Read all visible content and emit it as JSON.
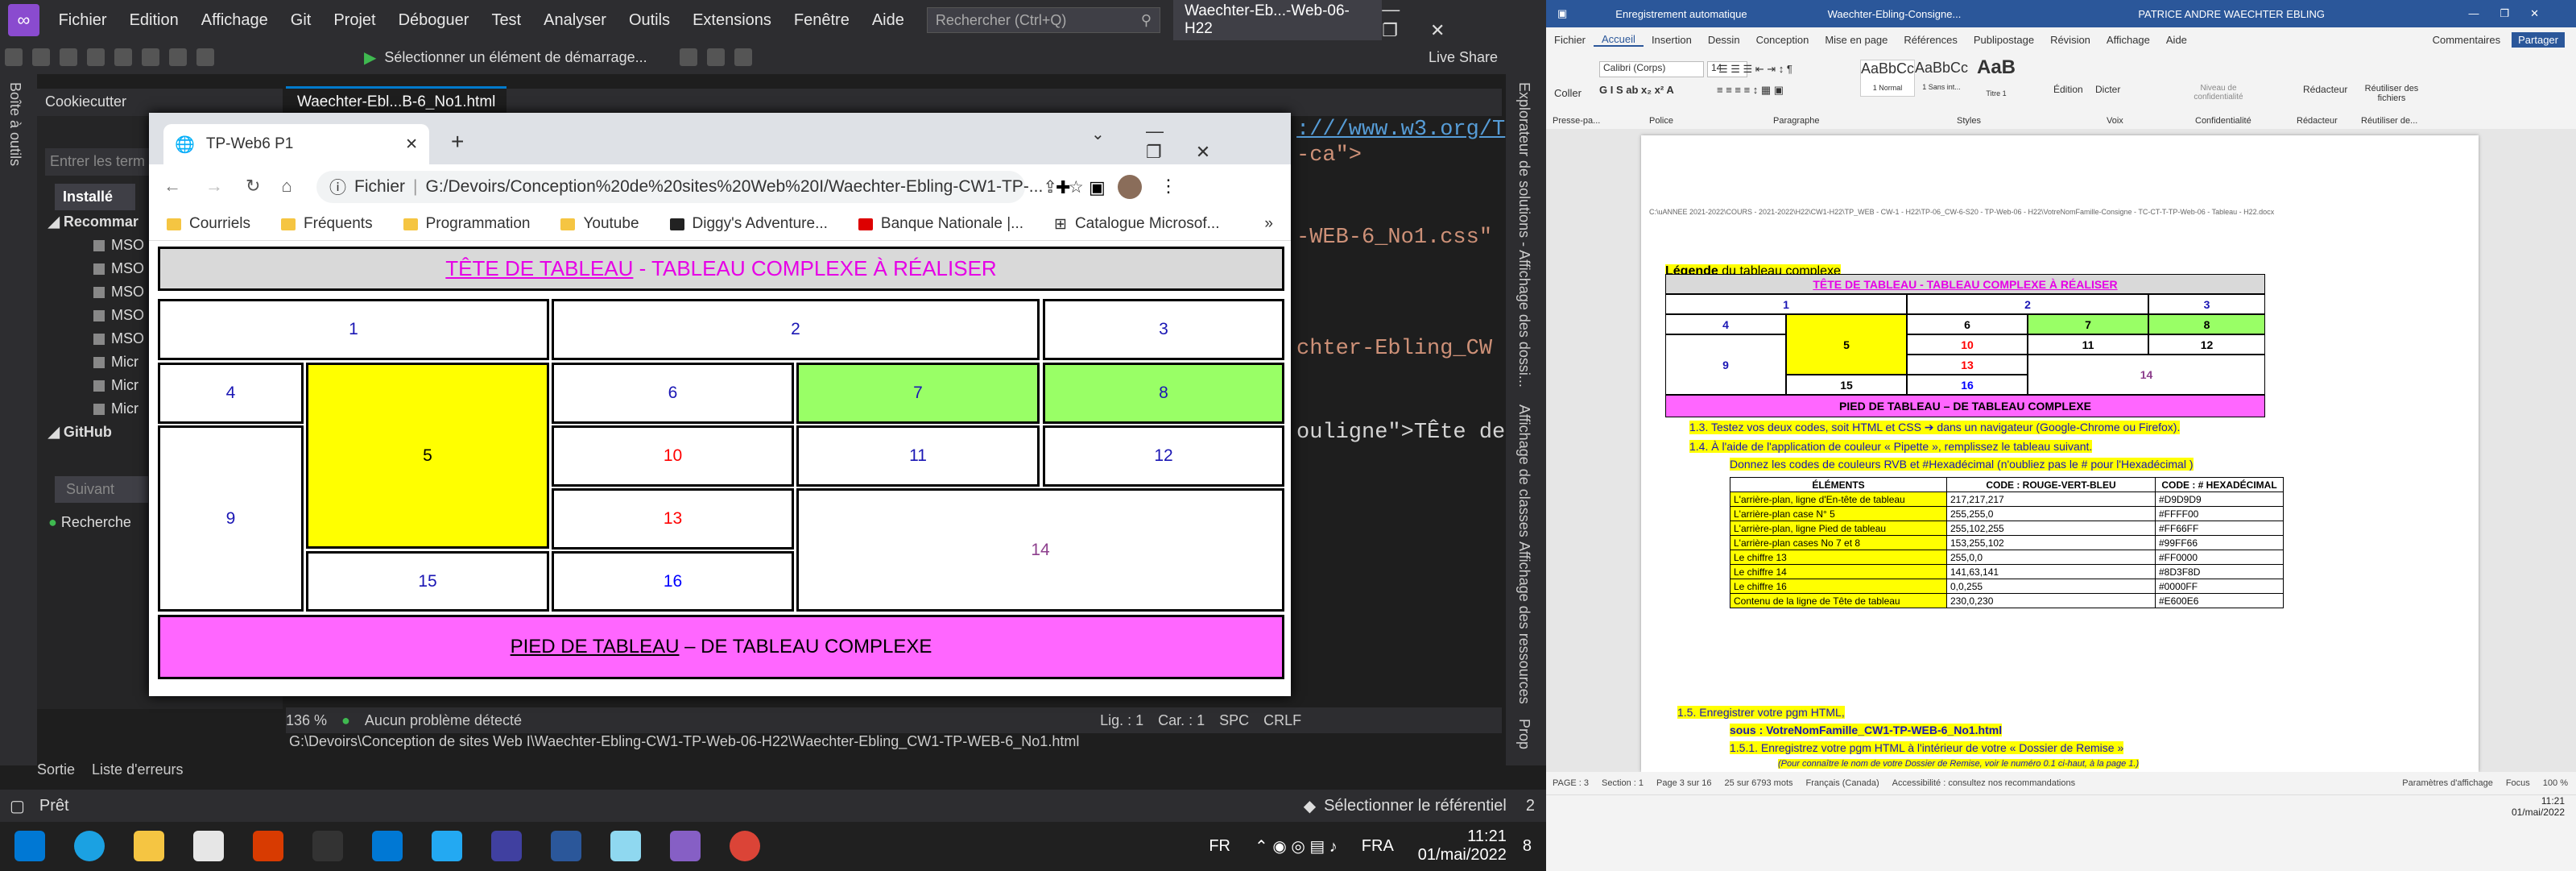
{
  "vs": {
    "menu": [
      "Fichier",
      "Edition",
      "Affichage",
      "Git",
      "Projet",
      "Déboguer",
      "Test",
      "Analyser",
      "Outils",
      "Extensions",
      "Fenêtre",
      "Aide"
    ],
    "search_placeholder": "Rechercher (Ctrl+Q)",
    "window_title": "Waechter-Eb...-Web-06-H22",
    "start_label": "Sélectionner un élément de démarrage...",
    "live_share": "Live Share",
    "left_strip": "Boîte à outils",
    "cookie_panel": {
      "title": "Cookiecutter",
      "search_placeholder": "Entrer les term",
      "installed": "Installé",
      "recommended": "Recommar",
      "items": [
        "MSO",
        "MSO",
        "MSO",
        "MSO",
        "MSO",
        "Micr",
        "Micr",
        "Micr"
      ],
      "github": "GitHub",
      "next_button": "Suivant",
      "search_status": "Recherche"
    },
    "editor_tab": "Waechter-Ebl...B-6_No1.html",
    "code_lines": [
      ":///www.w3.org/T",
      "-ca\">",
      "-WEB-6_No1.css\"",
      "chter-Ebling_CW",
      "ouligne\">TÊte de"
    ],
    "right_strip": [
      "Explorateur de solutions - Affichage des dossi...",
      "Affichage de classes",
      "Affichage des ressources",
      "Prop"
    ],
    "zoom": "136 %",
    "no_problem": "Aucun problème détecté",
    "line": "Lig. : 1",
    "col": "Car. : 1",
    "spc": "SPC",
    "crlf": "CRLF",
    "file_path": "G:\\Devoirs\\Conception de sites Web I\\Waechter-Ebling-CW1-TP-Web-06-H22\\Waechter-Ebling_CW1-TP-WEB-6_No1.html",
    "bottom_tabs": [
      "Sortie",
      "Liste d'erreurs"
    ],
    "status_ready": "Prêt",
    "select_repo": "Sélectionner le référentiel",
    "notif": "2"
  },
  "chrome": {
    "tab_title": "TP-Web6 P1",
    "url_label": "Fichier",
    "url": "G:/Devoirs/Conception%20de%20sites%20Web%20I/Waechter-Ebling-CW1-TP-...",
    "bookmarks": [
      "Courriels",
      "Fréquents",
      "Programmation",
      "Youtube",
      "Diggy's Adventure...",
      "Banque Nationale |...",
      "Catalogue Microsof..."
    ],
    "more": "»"
  },
  "table": {
    "head_part1": "TÊTE DE TABLEAU",
    "head_part2": " - TABLEAU COMPLEXE À RÉALISER",
    "foot_part1": "PIED DE TABLEAU",
    "foot_part2": " – DE TABLEAU COMPLEXE",
    "cells": {
      "c1": "1",
      "c2": "2",
      "c3": "3",
      "c4": "4",
      "c5": "5",
      "c6": "6",
      "c7": "7",
      "c8": "8",
      "c9": "9",
      "c10": "10",
      "c11": "11",
      "c12": "12",
      "c13": "13",
      "c14": "14",
      "c15": "15",
      "c16": "16"
    },
    "colors": {
      "header_bg": "#D9D9D9",
      "yellow": "#FFFF00",
      "green": "#99FF66",
      "footer_bg": "#FF66FF",
      "red": "#FF0000",
      "purple": "#8D3F8D",
      "blue": "#0000FF",
      "header_text": "#E600E6"
    }
  },
  "taskbar": {
    "lang": "FR",
    "lang2": "FRA",
    "time": "11:21",
    "date": "01/mai/2022",
    "notif": "8"
  },
  "word": {
    "autosave": "Enregistrement automatique",
    "doc_title": "Waechter-Ebling-Consigne...",
    "user": "PATRICE ANDRE WAECHTER EBLING",
    "tabs": [
      "Fichier",
      "Accueil",
      "Insertion",
      "Dessin",
      "Conception",
      "Mise en page",
      "Références",
      "Publipostage",
      "Révision",
      "Affichage",
      "Aide"
    ],
    "comments": "Commentaires",
    "share": "Partager",
    "font": "Calibri (Corps)",
    "size": "14",
    "groups": [
      "Presse-pa...",
      "Police",
      "Paragraphe",
      "Styles",
      "Voix",
      "Confidentialité",
      "Rédacteur",
      "Réutiliser de..."
    ],
    "styles": [
      "AaBbCc",
      "AaBbCc",
      "AaB"
    ],
    "style_names": [
      "1 Normal",
      "1 Sans int...",
      "Titre 1"
    ],
    "ribbon_buttons": [
      "Coller",
      "Édition",
      "Dicter",
      "Niveau de confidentialité",
      "Rédacteur",
      "Réutiliser des fichiers"
    ],
    "header_line": "C:\\uANNEE 2021-2022\\COURS - 2021-2022\\H22\\CW1-H22\\TP_WEB - CW-1 - H22\\TP-06_CW-6-S20 - TP-Web-06 - H22\\VotreNomFamille-Consigne - TC-CT-T-TP-Web-06 - Tableau - H22.docx",
    "legend_label": "Légende",
    "legend_text": " du tableau complexe",
    "mini_head": "TÊTE  DE  TABLEAU  -  TABLEAU  COMPLEXE  À  RÉALISER",
    "mini_foot": "PIED DE TABLEAU – DE TABLEAU COMPLEXE",
    "p13": "1.3.   Testez vos deux codes, soit HTML et CSS  ➔ dans un navigateur (Google-Chrome ou Firefox).",
    "p14": "1.4.   À l'aide de l'application de couleur « Pipette », remplissez le tableau suivant.",
    "p14b": "Donnez les codes de couleurs RVB  et  #Hexadécimal (n'oubliez pas le # pour l'Hexadécimal )",
    "codes_header": [
      "ÉLÉMENTS",
      "CODE : ROUGE-VERT-BLEU",
      "CODE :  # HEXADÉCIMAL"
    ],
    "codes_rows": [
      [
        "L'arrière-plan, ligne d'En-tête de tableau",
        "217,217,217",
        "#D9D9D9"
      ],
      [
        "L'arrière-plan case N° 5",
        "255,255,0",
        "#FFFF00"
      ],
      [
        "L'arrière-plan, ligne Pied de tableau",
        "255,102,255",
        "#FF66FF"
      ],
      [
        "L'arrière-plan cases No 7 et 8",
        "153,255,102",
        "#99FF66"
      ],
      [
        "Le chiffre  13",
        "255,0,0",
        "#FF0000"
      ],
      [
        "Le chiffre  14",
        "141,63,141",
        "#8D3F8D"
      ],
      [
        "Le chiffre  16",
        "0,0,255",
        "#0000FF"
      ],
      [
        "Contenu de la ligne de Tête de tableau",
        "230,0,230",
        "#E600E6"
      ]
    ],
    "p15": "1.5.   Enregistrer votre pgm HTML,",
    "p15b": "sous : VotreNomFamille_CW1-TP-WEB-6_No1.html",
    "p151": "1.5.1. Enregistrez votre pgm HTML à l'intérieur de votre « Dossier de Remise »",
    "p151b": "(Pour connaître le nom de votre Dossier de Remise, voir le numéro 0.1 ci-haut, à la page 1.)",
    "status": [
      "PAGE : 3",
      "Section : 1",
      "Page 3 sur 16",
      "25 sur 6793 mots",
      "Français (Canada)",
      "Accessibilité : consultez nos recommandations",
      "Paramètres d'affichage",
      "Focus",
      "100 %"
    ],
    "time": "11:21",
    "date": "01/mai/2022"
  }
}
